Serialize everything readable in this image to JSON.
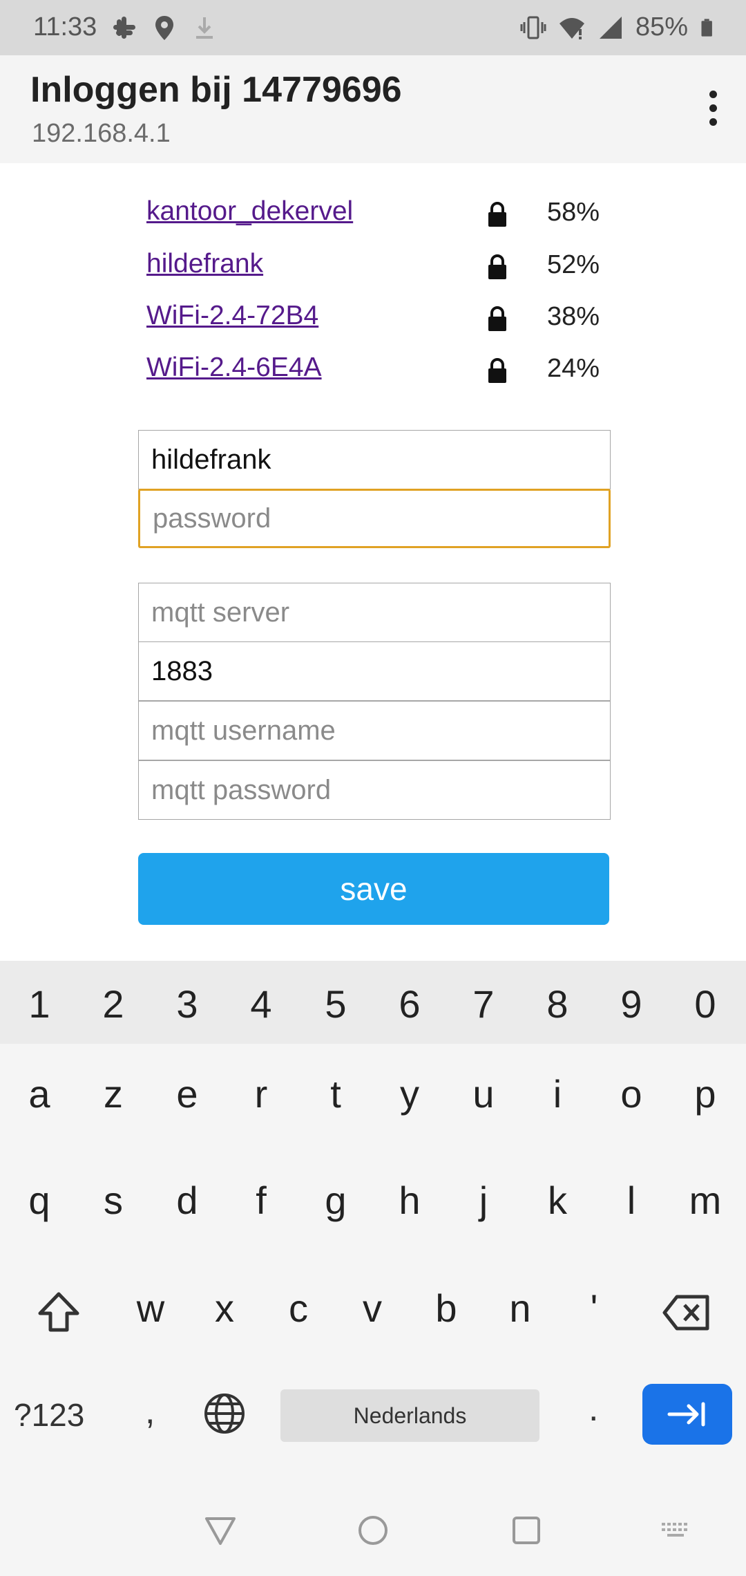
{
  "status_bar": {
    "time": "11:33",
    "battery": "85%",
    "left_icons": [
      "slack-icon",
      "location-icon",
      "download-icon"
    ],
    "right_icons": [
      "vibrate-icon",
      "wifi-icon",
      "signal-icon",
      "battery-icon"
    ]
  },
  "app_bar": {
    "title": "Inloggen bij 14779696",
    "url": "192.168.4.1",
    "menu_icon": "more-vert-icon"
  },
  "networks": [
    {
      "name": "kantoor_dekervel",
      "strength": "58%",
      "icon": "lock-icon"
    },
    {
      "name": "hildefrank",
      "strength": "52%",
      "icon": "lock-icon"
    },
    {
      "name": "WiFi-2.4-72B4",
      "strength": "38%",
      "icon": "lock-icon"
    },
    {
      "name": "WiFi-2.4-6E4A",
      "strength": "24%",
      "icon": "lock-icon"
    }
  ],
  "form": {
    "ssid_value": "hildefrank",
    "password_placeholder": "password",
    "mqtt_server_placeholder": "mqtt server",
    "mqtt_port_value": "1883",
    "mqtt_username_placeholder": "mqtt username",
    "mqtt_password_placeholder": "mqtt password",
    "save_label": "save",
    "focused_color": "#e0a224",
    "button_color": "#1fa3ec"
  },
  "keyboard": {
    "numbers": [
      "1",
      "2",
      "3",
      "4",
      "5",
      "6",
      "7",
      "8",
      "9",
      "0"
    ],
    "row1": [
      "a",
      "z",
      "e",
      "r",
      "t",
      "y",
      "u",
      "i",
      "o",
      "p"
    ],
    "row2": [
      "q",
      "s",
      "d",
      "f",
      "g",
      "h",
      "j",
      "k",
      "l",
      "m"
    ],
    "row3": [
      "w",
      "x",
      "c",
      "v",
      "b",
      "n",
      "'"
    ],
    "symbols_label": "?123",
    "comma": ",",
    "space_label": "Nederlands",
    "period": ".",
    "enter_color": "#1a73e8"
  },
  "nav_bar": {
    "icons": [
      "back-icon",
      "home-icon",
      "recents-icon",
      "keyboard-icon"
    ]
  }
}
